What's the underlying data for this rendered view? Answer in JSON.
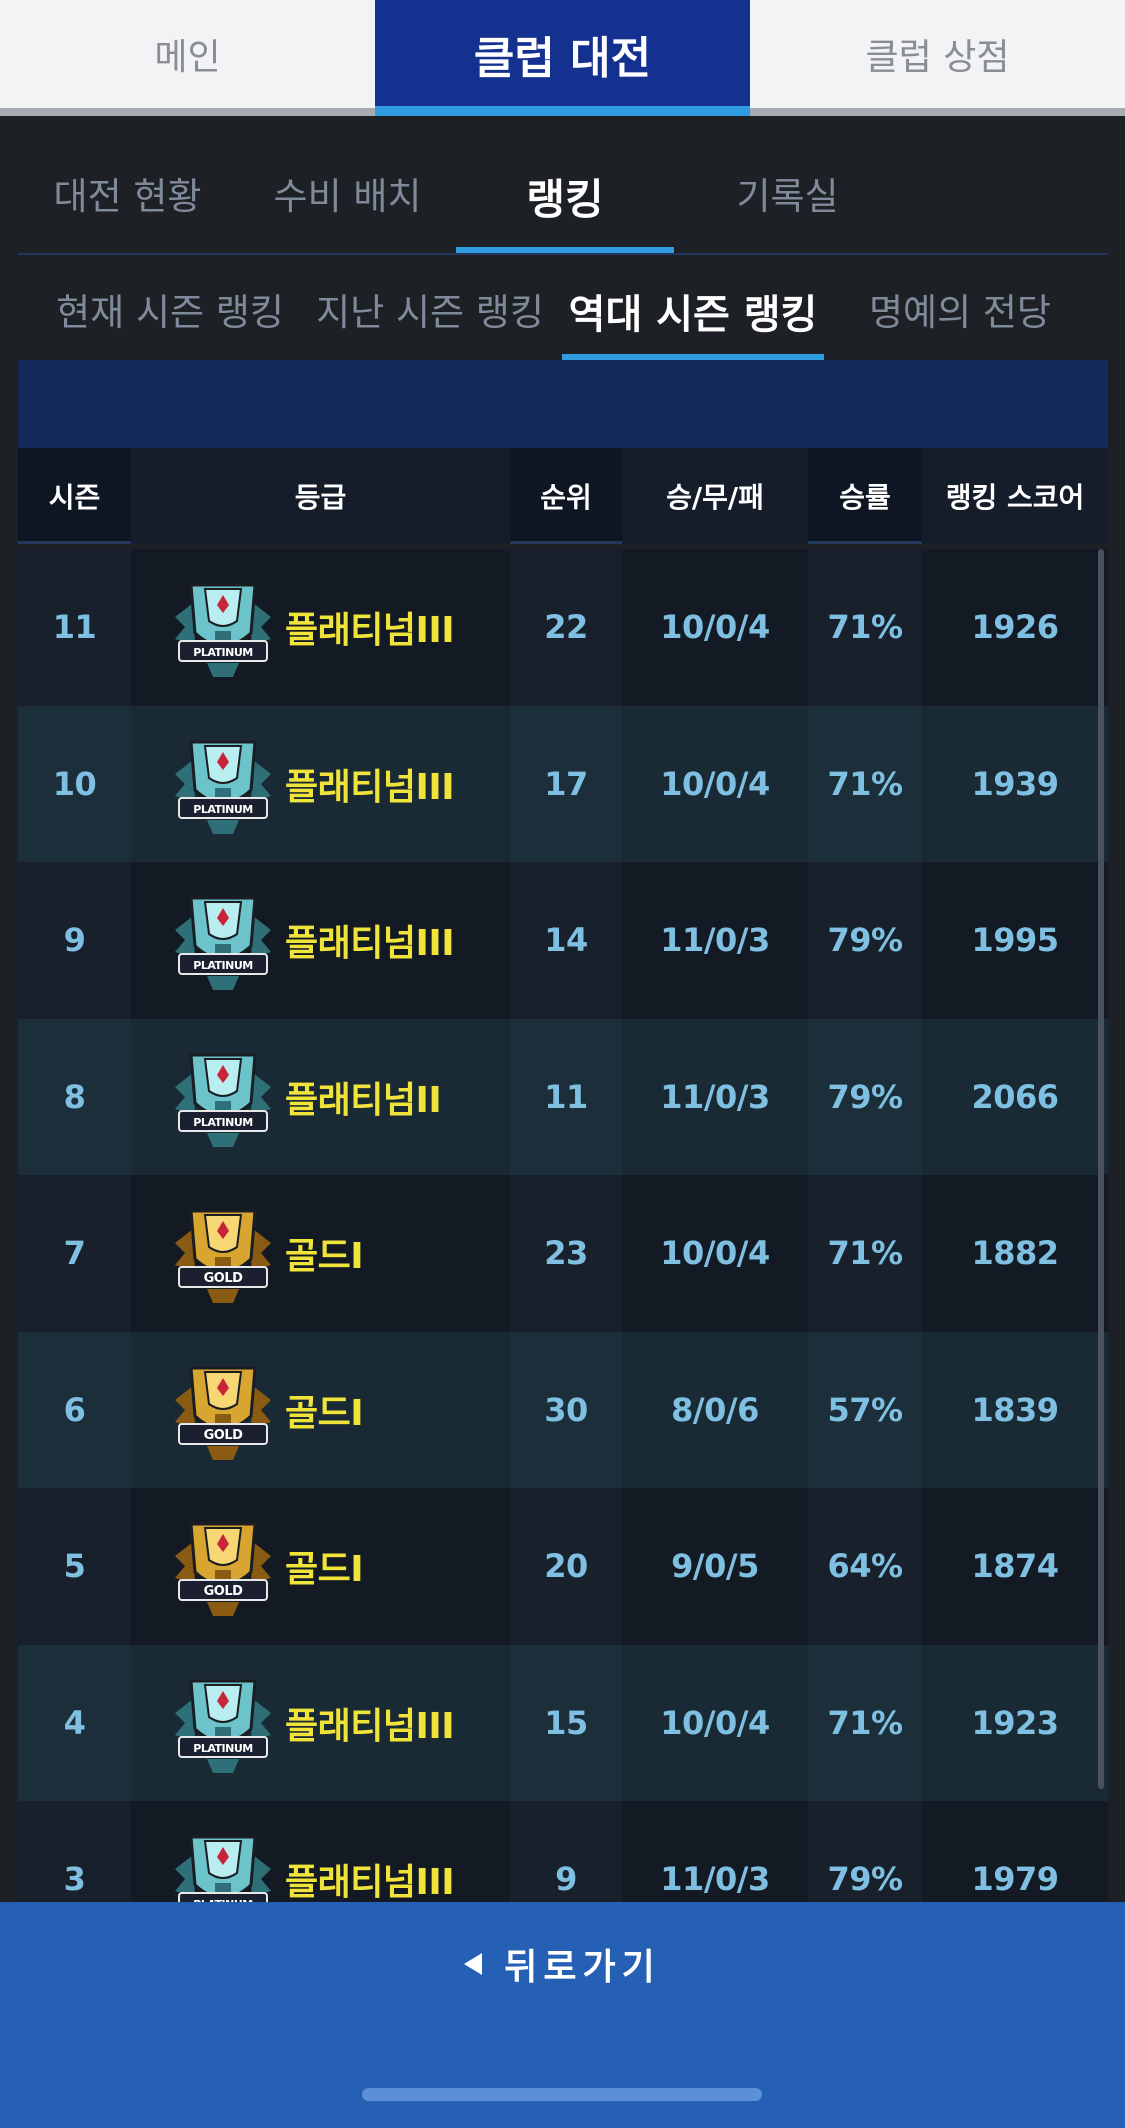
{
  "top_tabs": [
    "메인",
    "클럽 대전",
    "클럽 상점"
  ],
  "sub_tabs": [
    "대전 현황",
    "수비 배치",
    "랭킹",
    "기록실"
  ],
  "season_tabs": [
    "현재 시즌 랭킹",
    "지난 시즌 랭킹",
    "역대 시즌 랭킹",
    "명예의 전당"
  ],
  "table": {
    "headers": [
      "시즌",
      "등급",
      "순위",
      "승/무/패",
      "승률",
      "랭킹 스코어"
    ],
    "rows": [
      {
        "season": "11",
        "tier": "플래티넘III",
        "badge": "platinum",
        "rank": "22",
        "record": "10/0/4",
        "winrate": "71%",
        "score": "1926"
      },
      {
        "season": "10",
        "tier": "플래티넘III",
        "badge": "platinum",
        "rank": "17",
        "record": "10/0/4",
        "winrate": "71%",
        "score": "1939"
      },
      {
        "season": "9",
        "tier": "플래티넘III",
        "badge": "platinum",
        "rank": "14",
        "record": "11/0/3",
        "winrate": "79%",
        "score": "1995"
      },
      {
        "season": "8",
        "tier": "플래티넘II",
        "badge": "platinum",
        "rank": "11",
        "record": "11/0/3",
        "winrate": "79%",
        "score": "2066"
      },
      {
        "season": "7",
        "tier": "골드I",
        "badge": "gold",
        "rank": "23",
        "record": "10/0/4",
        "winrate": "71%",
        "score": "1882"
      },
      {
        "season": "6",
        "tier": "골드I",
        "badge": "gold",
        "rank": "30",
        "record": "8/0/6",
        "winrate": "57%",
        "score": "1839"
      },
      {
        "season": "5",
        "tier": "골드I",
        "badge": "gold",
        "rank": "20",
        "record": "9/0/5",
        "winrate": "64%",
        "score": "1874"
      },
      {
        "season": "4",
        "tier": "플래티넘III",
        "badge": "platinum",
        "rank": "15",
        "record": "10/0/4",
        "winrate": "71%",
        "score": "1923"
      },
      {
        "season": "3",
        "tier": "플래티넘III",
        "badge": "platinum",
        "rank": "9",
        "record": "11/0/3",
        "winrate": "79%",
        "score": "1979"
      }
    ]
  },
  "badges": {
    "platinum": {
      "label": "PLATINUM",
      "color": "#6cc3c9"
    },
    "gold": {
      "label": "GOLD",
      "color": "#d9a531"
    }
  },
  "back_label": "뒤로가기",
  "colors": {
    "accent": "#2f9be0",
    "header_blue": "#14318f",
    "bottom_bar": "#2560b5",
    "tier_text": "#f0e43a",
    "value_text": "#7fc0e2"
  }
}
